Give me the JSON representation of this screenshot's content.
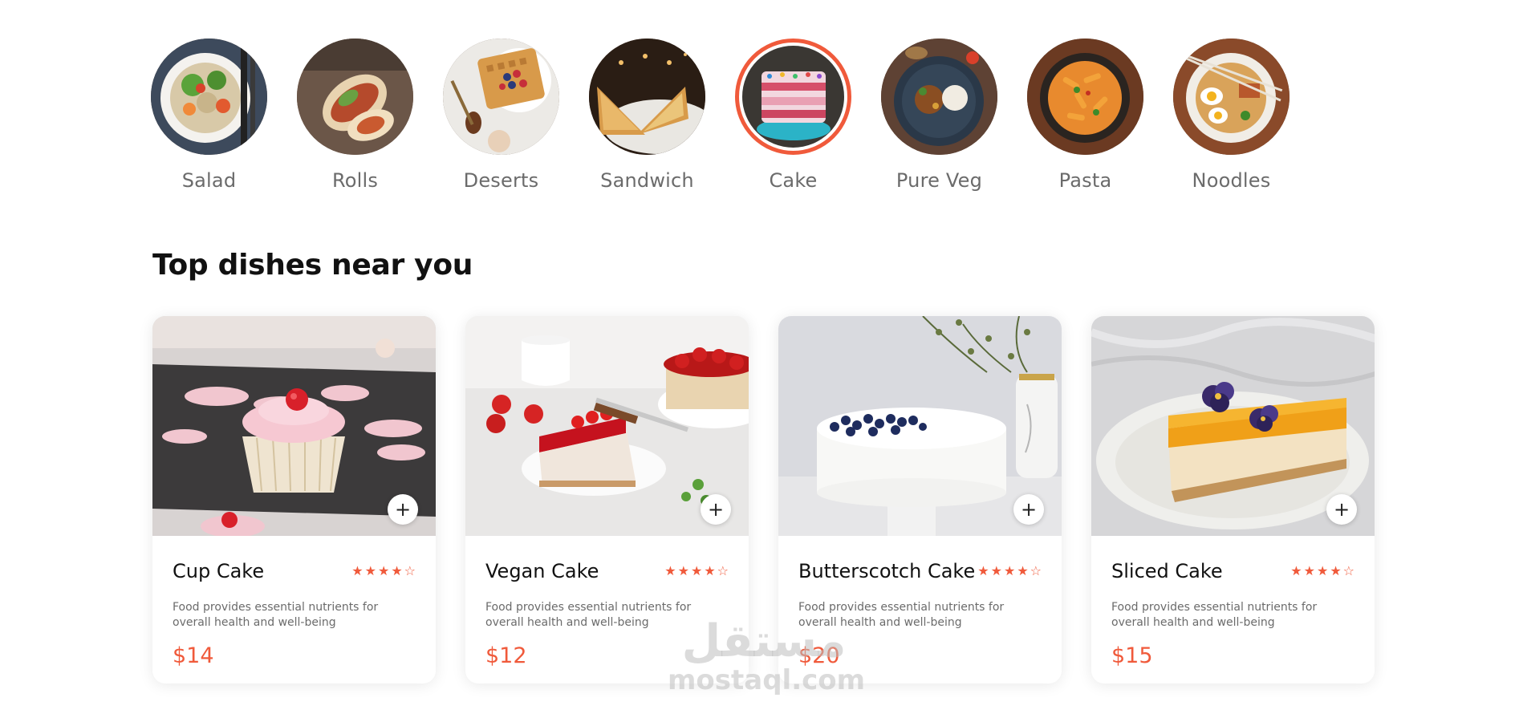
{
  "categories": [
    {
      "label": "Salad",
      "active": false
    },
    {
      "label": "Rolls",
      "active": false
    },
    {
      "label": "Deserts",
      "active": false
    },
    {
      "label": "Sandwich",
      "active": false
    },
    {
      "label": "Cake",
      "active": true
    },
    {
      "label": "Pure Veg",
      "active": false
    },
    {
      "label": "Pasta",
      "active": false
    },
    {
      "label": "Noodles",
      "active": false
    }
  ],
  "section": {
    "title": "Top dishes near you"
  },
  "dishes": [
    {
      "name": "Cup Cake",
      "rating": 4,
      "rating_max": 5,
      "description": "Food provides essential nutrients for overall health and well-being",
      "price": "$14",
      "add_label": "+"
    },
    {
      "name": "Vegan Cake",
      "rating": 4,
      "rating_max": 5,
      "description": "Food provides essential nutrients for overall health and well-being",
      "price": "$12",
      "add_label": "+"
    },
    {
      "name": "Butterscotch Cake",
      "rating": 4,
      "rating_max": 5,
      "description": "Food provides essential nutrients for overall health and well-being",
      "price": "$20",
      "add_label": "+"
    },
    {
      "name": "Sliced Cake",
      "rating": 4,
      "rating_max": 5,
      "description": "Food provides essential nutrients for overall health and well-being",
      "price": "$15",
      "add_label": "+"
    }
  ],
  "watermark": {
    "arabic": "مستقل",
    "latin": "mostaql.com"
  },
  "colors": {
    "accent": "#f05a3b",
    "label_gray": "#6b6b6b",
    "title": "#111111"
  }
}
